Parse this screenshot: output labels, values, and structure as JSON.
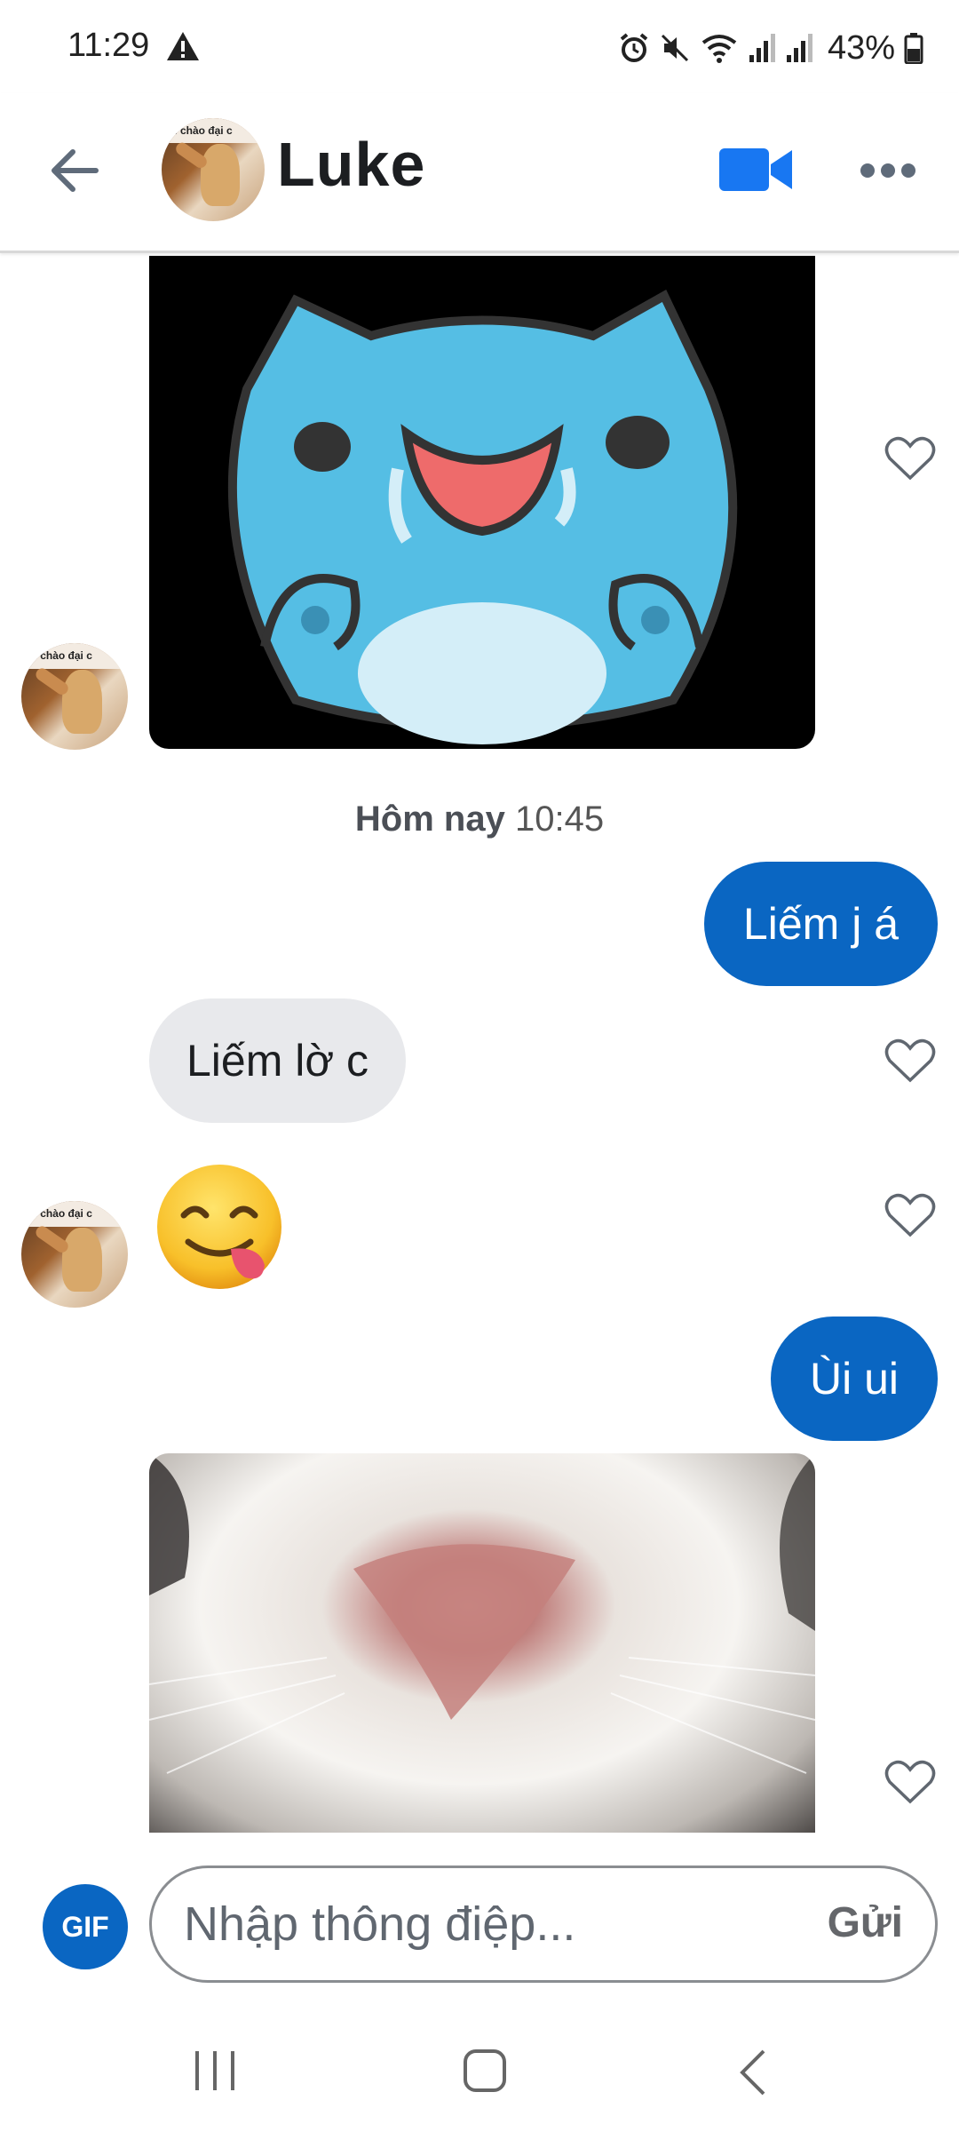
{
  "status_bar": {
    "time": "11:29",
    "battery": "43%",
    "icons": [
      "warning-icon",
      "alarm-icon",
      "mute-icon",
      "wifi-icon",
      "signal-icon",
      "signal-icon",
      "battery-icon"
    ]
  },
  "header": {
    "contact_name": "Luke",
    "avatar_text": "m chào đại c",
    "icons": {
      "back": "back-arrow-icon",
      "video": "video-camera-icon",
      "more": "more-dots-icon"
    },
    "accent_color": "#0a66c2"
  },
  "messages": [
    {
      "type": "gif",
      "from": "contact",
      "description_icon": "blue-cat-gif",
      "liked": false
    },
    {
      "type": "timestamp",
      "day": "Hôm nay",
      "time": "10:45"
    },
    {
      "type": "text",
      "from": "me",
      "text": "Liếm j á"
    },
    {
      "type": "text",
      "from": "contact",
      "text": "Liếm lờ c"
    },
    {
      "type": "emoji",
      "from": "contact",
      "icon": "face-savoring-food-emoji"
    },
    {
      "type": "text",
      "from": "me",
      "text": "Ùi ui"
    },
    {
      "type": "gif",
      "from": "contact",
      "description_icon": "cat-nose-gif"
    }
  ],
  "composer": {
    "gif_label": "GIF",
    "placeholder": "Nhập thông điệp...",
    "send_label": "Gửi"
  },
  "nav_bar": {
    "icons": [
      "recent-apps-icon",
      "home-icon",
      "back-icon"
    ]
  }
}
